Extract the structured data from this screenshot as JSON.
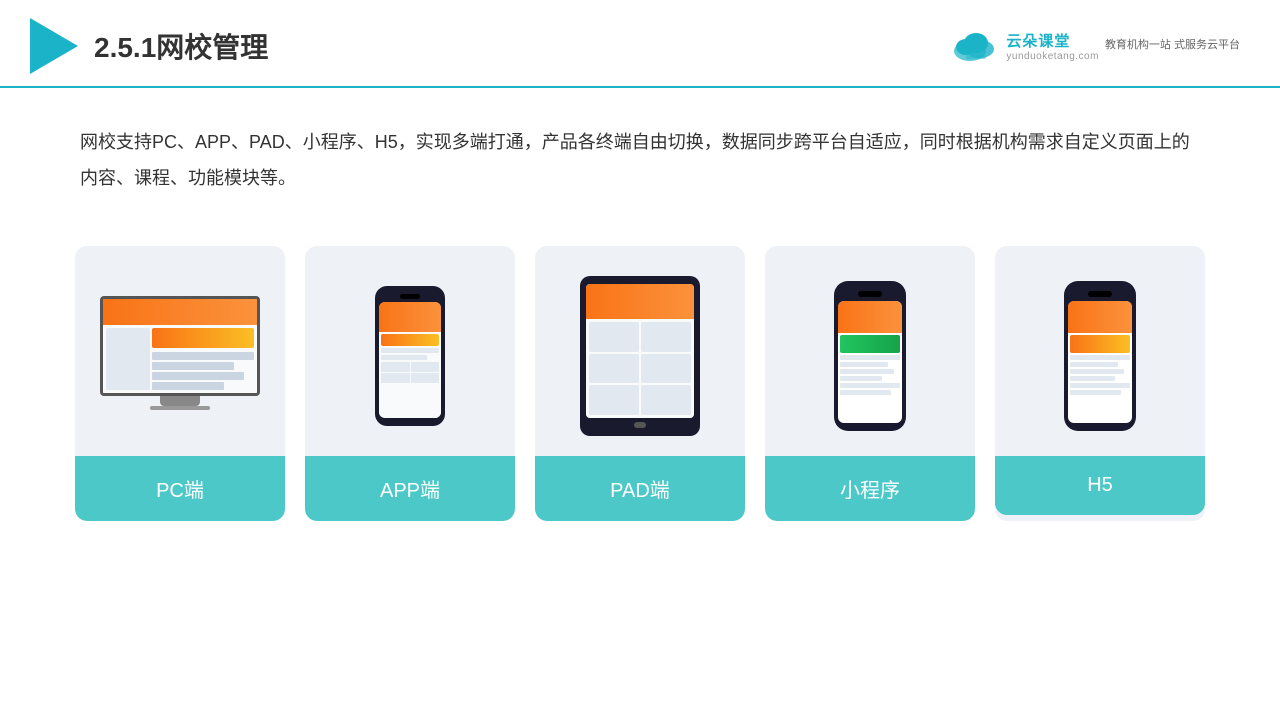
{
  "header": {
    "title": "2.5.1网校管理",
    "brand": {
      "name": "云朵课堂",
      "url": "yunduoketang.com",
      "slogan": "教育机构一站\n式服务云平台"
    }
  },
  "description": {
    "text": "网校支持PC、APP、PAD、小程序、H5，实现多端打通，产品各终端自由切换，数据同步跨平台自适应，同时根据机构需求自定义页面上的内容、课程、功能模块等。"
  },
  "cards": [
    {
      "id": "pc",
      "label": "PC端"
    },
    {
      "id": "app",
      "label": "APP端"
    },
    {
      "id": "pad",
      "label": "PAD端"
    },
    {
      "id": "mini",
      "label": "小程序"
    },
    {
      "id": "h5",
      "label": "H5"
    }
  ],
  "colors": {
    "accent": "#1ab3c8",
    "card_bg": "#eef2f7",
    "label_bg": "#4dc8c8"
  }
}
